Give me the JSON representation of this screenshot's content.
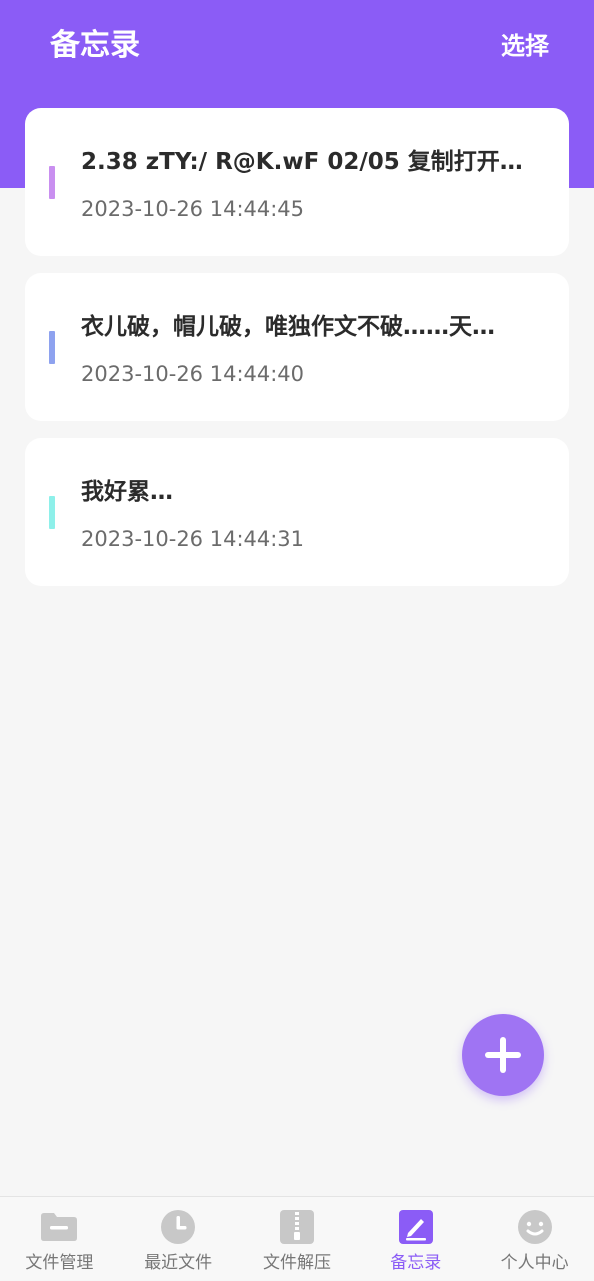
{
  "header": {
    "title": "备忘录",
    "action_label": "选择"
  },
  "notes": [
    {
      "title": "2.38 zTY:/ R@K.wF 02/05  复制打开…",
      "time": "2023-10-26 14:44:45",
      "accent_color": "#c98ff0"
    },
    {
      "title": "衣儿破，帽儿破，唯独作文不破……天…",
      "time": "2023-10-26 14:44:40",
      "accent_color": "#8ea2ef"
    },
    {
      "title": "我好累…",
      "time": "2023-10-26 14:44:31",
      "accent_color": "#8ef0ea"
    }
  ],
  "fab": {
    "icon": "plus-icon"
  },
  "tabbar": {
    "active_index": 3,
    "items": [
      {
        "label": "文件管理",
        "icon": "folder-icon"
      },
      {
        "label": "最近文件",
        "icon": "clock-icon"
      },
      {
        "label": "文件解压",
        "icon": "zip-icon"
      },
      {
        "label": "备忘录",
        "icon": "memo-edit-icon"
      },
      {
        "label": "个人中心",
        "icon": "smiley-icon"
      }
    ]
  },
  "colors": {
    "brand": "#8b5cf6",
    "background": "#f6f6f6",
    "tab_inactive": "#c8c8c8"
  }
}
